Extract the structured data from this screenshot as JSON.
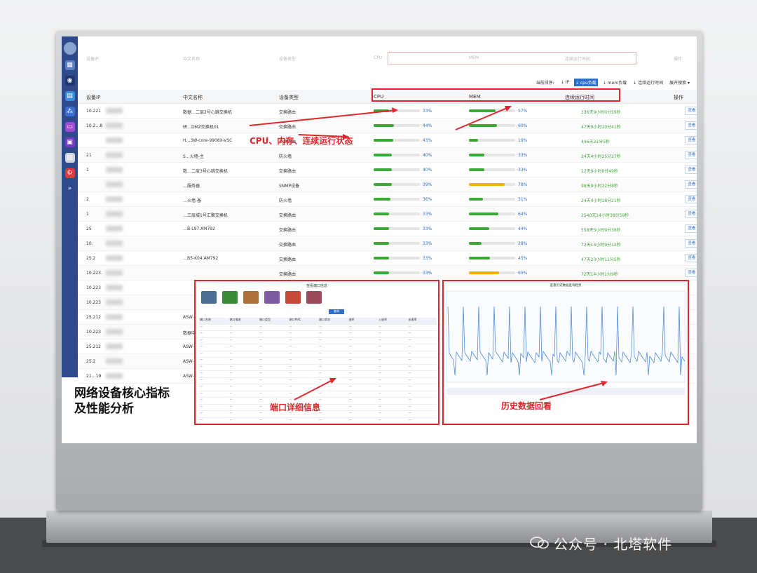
{
  "sort_bar": {
    "label": "当前排序:",
    "options": [
      "↓ IP",
      "↓ cpu负载",
      "↓ mem负载",
      "↓ 连续运行时间"
    ],
    "active_index": 1,
    "expand": "展开搜索 ▾"
  },
  "columns": {
    "ip": "设备IP",
    "name": "中文名称",
    "type": "设备类型",
    "cpu": "CPU",
    "mem": "MEM",
    "uptime": "连续运行时间",
    "action": "操作"
  },
  "rows": [
    {
      "ip": "10.221",
      "name": "数据…二层2号心跳交换机",
      "type": "交换路由",
      "cpu": 33,
      "cpu_label": "33%",
      "mem": 57,
      "mem_label": "57%",
      "uptime": "336天9小时0分59秒",
      "action": "查看"
    },
    {
      "ip": "10.2…8",
      "name": "研…DMZ交换机01",
      "type": "交换路由",
      "cpu": 44,
      "cpu_label": "44%",
      "mem": 60,
      "mem_label": "60%",
      "uptime": "47天9小时10分41秒",
      "action": "查看"
    },
    {
      "ip": "",
      "name": "H…3W-core-9908X-VSC",
      "type": "交换路由",
      "cpu": 43,
      "cpu_label": "43%",
      "mem": 19,
      "mem_label": "19%",
      "uptime": "446天21分5秒",
      "action": "查看"
    },
    {
      "ip": "21",
      "name": "S…火墙-主",
      "type": "防火墙",
      "cpu": 40,
      "cpu_label": "40%",
      "mem": 33,
      "mem_label": "33%",
      "uptime": "24天4小时25分27秒",
      "action": "查看"
    },
    {
      "ip": "1",
      "name": "数…二层3号心跳交换机",
      "type": "交换路由",
      "cpu": 40,
      "cpu_label": "40%",
      "mem": 33,
      "mem_label": "33%",
      "uptime": "12天9小时0分49秒",
      "action": "查看"
    },
    {
      "ip": "",
      "name": "…服务器",
      "type": "SNMP设备",
      "cpu": 39,
      "cpu_label": "39%",
      "mem": 78,
      "mem_label": "78%",
      "uptime": "98天9小时22分8秒",
      "action": "查看"
    },
    {
      "ip": "2",
      "name": "…火墙-备",
      "type": "防火墙",
      "cpu": 36,
      "cpu_label": "36%",
      "mem": 31,
      "mem_label": "31%",
      "uptime": "24天4小时18分21秒",
      "action": "查看"
    },
    {
      "ip": "1",
      "name": "…三层城1号汇聚交换机",
      "type": "交换路由",
      "cpu": 33,
      "cpu_label": "33%",
      "mem": 64,
      "mem_label": "64%",
      "uptime": "2540天14小时38分59秒",
      "action": "查看"
    },
    {
      "ip": "25",
      "name": "…B-L97.AM792",
      "type": "交换路由",
      "cpu": 33,
      "cpu_label": "33%",
      "mem": 44,
      "mem_label": "44%",
      "uptime": "558天5小时9分38秒",
      "action": "查看"
    },
    {
      "ip": "10.",
      "name": "",
      "type": "交换路由",
      "cpu": 33,
      "cpu_label": "33%",
      "mem": 28,
      "mem_label": "28%",
      "uptime": "72天14小时9分12秒",
      "action": "查看"
    },
    {
      "ip": "25.2",
      "name": "…B5-K04.AM792",
      "type": "交换路由",
      "cpu": 33,
      "cpu_label": "33%",
      "mem": 45,
      "mem_label": "45%",
      "uptime": "47天23小时11分5秒",
      "action": "查看"
    },
    {
      "ip": "10.223.",
      "name": "",
      "type": "交换路由",
      "cpu": 33,
      "cpu_label": "33%",
      "mem": 65,
      "mem_label": "65%",
      "uptime": "72天14小时1分9秒",
      "action": "查看"
    },
    {
      "ip": "10.223",
      "name": "",
      "type": "",
      "cpu": null,
      "mem": null,
      "uptime": "",
      "action": ""
    },
    {
      "ip": "10.223",
      "name": "",
      "type": "",
      "cpu": null,
      "mem": null,
      "uptime": "",
      "action": ""
    },
    {
      "ip": "25.212",
      "name": "ASW-",
      "type": "",
      "cpu": null,
      "mem": null,
      "uptime": "",
      "action": ""
    },
    {
      "ip": "10.223",
      "name": "数据中",
      "type": "",
      "cpu": null,
      "mem": null,
      "uptime": "",
      "action": ""
    },
    {
      "ip": "25.212",
      "name": "ASW-",
      "type": "",
      "cpu": null,
      "mem": null,
      "uptime": "",
      "action": ""
    },
    {
      "ip": "25.2",
      "name": "ASW-",
      "type": "",
      "cpu": null,
      "mem": null,
      "uptime": "",
      "action": ""
    },
    {
      "ip": "21…19",
      "name": "ASW-",
      "type": "",
      "cpu": null,
      "mem": null,
      "uptime": "",
      "action": ""
    }
  ],
  "annotations": {
    "status": "CPU、内存、连续运行状态",
    "port": "端口详细信息",
    "history": "历史数据回看",
    "core_line1": "网络设备核心指标",
    "core_line2": "及性能分析"
  },
  "colors": {
    "accent": "#e3262c",
    "bar_green": "#3aa935",
    "bar_yellow": "#f2b200",
    "link": "#2c6fc7",
    "sidebar": "#2e4a8a"
  },
  "port_panel": {
    "title": "查看端口信息",
    "search_button": "查询",
    "headers": [
      "端口名称",
      "端口描述",
      "端口类型",
      "端口MAC",
      "端口状态",
      "速率",
      "入速率",
      "出速率"
    ],
    "row_count": 16
  },
  "history_panel": {
    "title": "查看历史数据查询趋势"
  },
  "watermark": "公众号 · 北塔软件"
}
